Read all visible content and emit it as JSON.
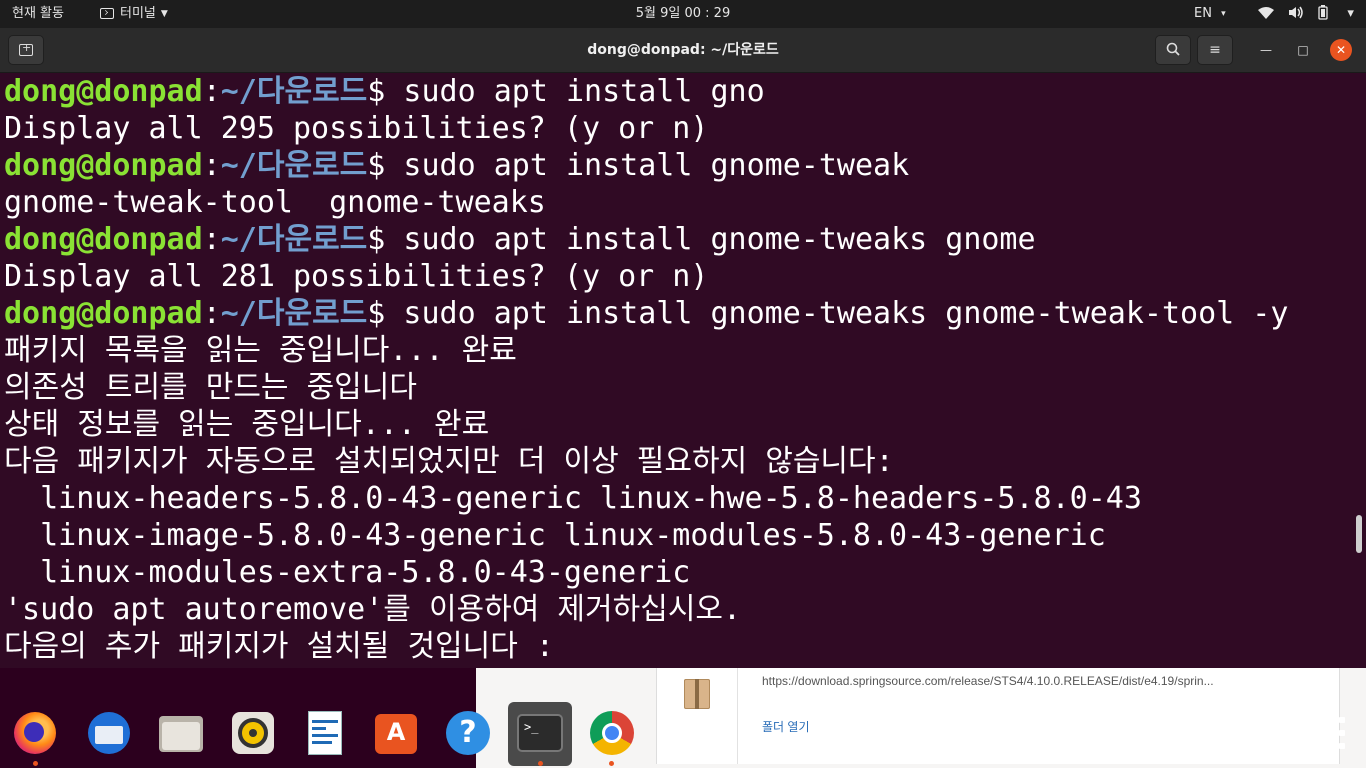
{
  "topbar": {
    "activities": "현재 활동",
    "app_menu": "터미널",
    "clock": "5월 9일  00 : 29",
    "lang": "EN",
    "lang_caret": "▾",
    "tray_caret": "▾"
  },
  "window": {
    "title": "dong@donpad: ~/다운로드",
    "search_icon_glyph": "⌕",
    "menu_icon_glyph": "≡",
    "minimize_glyph": "—",
    "maximize_glyph": "□",
    "close_glyph": "✕"
  },
  "prompt": {
    "user": "dong@donpad",
    "colon": ":",
    "path": "~/다운로드",
    "dollar": "$"
  },
  "terminal_lines": [
    {
      "type": "prompt",
      "command": " sudo apt install gno"
    },
    {
      "type": "output",
      "text": "Display all 295 possibilities? (y or n)"
    },
    {
      "type": "prompt",
      "command": " sudo apt install gnome-tweak"
    },
    {
      "type": "output",
      "text": "gnome-tweak-tool  gnome-tweaks"
    },
    {
      "type": "prompt",
      "command": " sudo apt install gnome-tweaks gnome"
    },
    {
      "type": "output",
      "text": "Display all 281 possibilities? (y or n)"
    },
    {
      "type": "prompt",
      "command": " sudo apt install gnome-tweaks gnome-tweak-tool -y"
    },
    {
      "type": "output",
      "text": "패키지 목록을 읽는 중입니다... 완료"
    },
    {
      "type": "output",
      "text": "의존성 트리를 만드는 중입니다"
    },
    {
      "type": "output",
      "text": "상태 정보를 읽는 중입니다... 완료"
    },
    {
      "type": "output",
      "text": "다음 패키지가 자동으로 설치되었지만 더 이상 필요하지 않습니다:"
    },
    {
      "type": "output",
      "text": "  linux-headers-5.8.0-43-generic linux-hwe-5.8-headers-5.8.0-43"
    },
    {
      "type": "output",
      "text": "  linux-image-5.8.0-43-generic linux-modules-5.8.0-43-generic"
    },
    {
      "type": "output",
      "text": "  linux-modules-extra-5.8.0-43-generic"
    },
    {
      "type": "output",
      "text": "'sudo apt autoremove'를 이용하여 제거하십시오."
    },
    {
      "type": "output",
      "text": "다음의 추가 패키지가 설치될 것입니다 :"
    }
  ],
  "download": {
    "url": "https://download.springsource.com/release/STS4/4.10.0.RELEASE/dist/e4.19/sprin...",
    "open_folder": "폴더 열기"
  },
  "dock": {
    "items": [
      {
        "name": "firefox-icon",
        "running": true
      },
      {
        "name": "thunderbird-icon",
        "running": false
      },
      {
        "name": "files-icon",
        "running": false
      },
      {
        "name": "rhythmbox-icon",
        "running": false
      },
      {
        "name": "libreoffice-writer-icon",
        "running": false
      },
      {
        "name": "ubuntu-software-icon",
        "running": false
      },
      {
        "name": "help-icon",
        "running": false
      },
      {
        "name": "terminal-icon",
        "running": true
      },
      {
        "name": "chrome-icon",
        "running": true
      }
    ],
    "help_glyph": "?",
    "software_glyph": "A",
    "terminal_glyph": ">_"
  },
  "colors": {
    "terminal_bg": "#300a24",
    "prompt_user": "#8ae234",
    "prompt_path": "#729fcf",
    "accent": "#e95420"
  }
}
